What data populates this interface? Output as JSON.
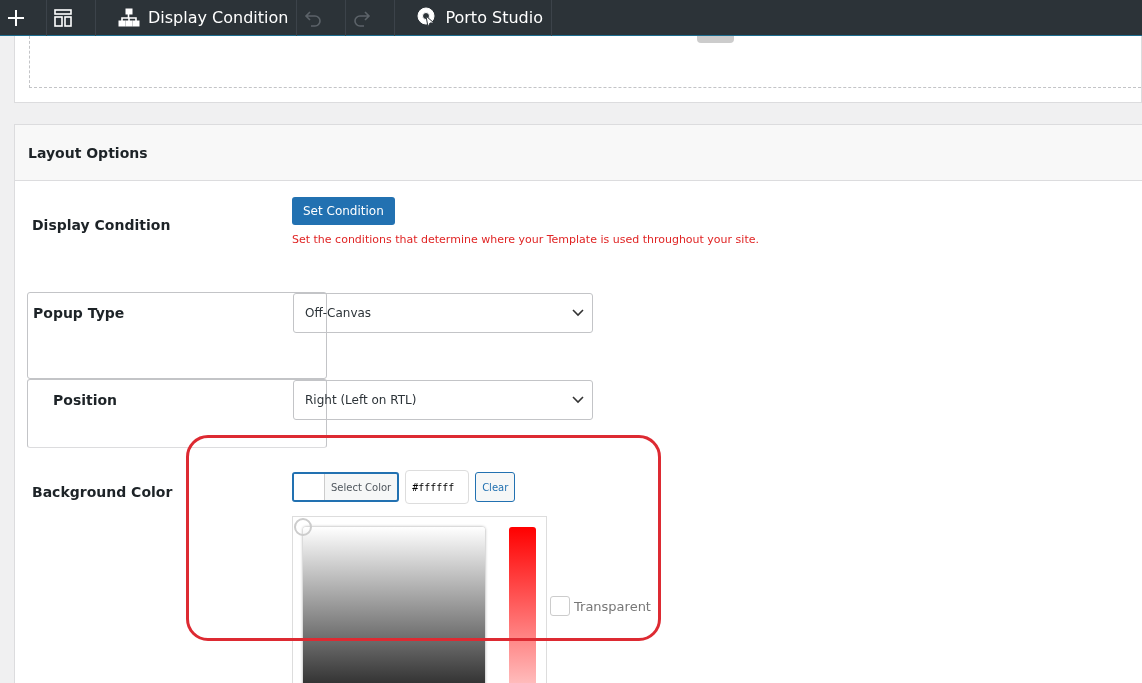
{
  "toolbar": {
    "items": [
      {
        "kind": "add"
      },
      {
        "kind": "layout"
      },
      {
        "kind": "conditions",
        "label": "Display Condition"
      },
      {
        "kind": "undo",
        "disabled": true
      },
      {
        "kind": "redo",
        "disabled": true
      },
      {
        "kind": "studio",
        "label": "Porto Studio"
      }
    ]
  },
  "panel": {
    "title": "Layout Options",
    "rows": [
      {
        "kind": "button",
        "label": "Display Condition",
        "button": "Set Condition",
        "note": "Set the conditions that determine where your Template is used throughout your site."
      },
      {
        "kind": "select",
        "label": "Popup Type",
        "value": "Off-Canvas",
        "indented": false
      },
      {
        "kind": "select",
        "label": "Position",
        "value": "Right (Left on RTL)",
        "indented": true
      },
      {
        "kind": "color",
        "label": "Background Color",
        "select_label": "Select Color",
        "value": "#ffffff",
        "clear": "Clear",
        "transparent": {
          "label": "Transparent",
          "checked": false
        }
      }
    ]
  }
}
